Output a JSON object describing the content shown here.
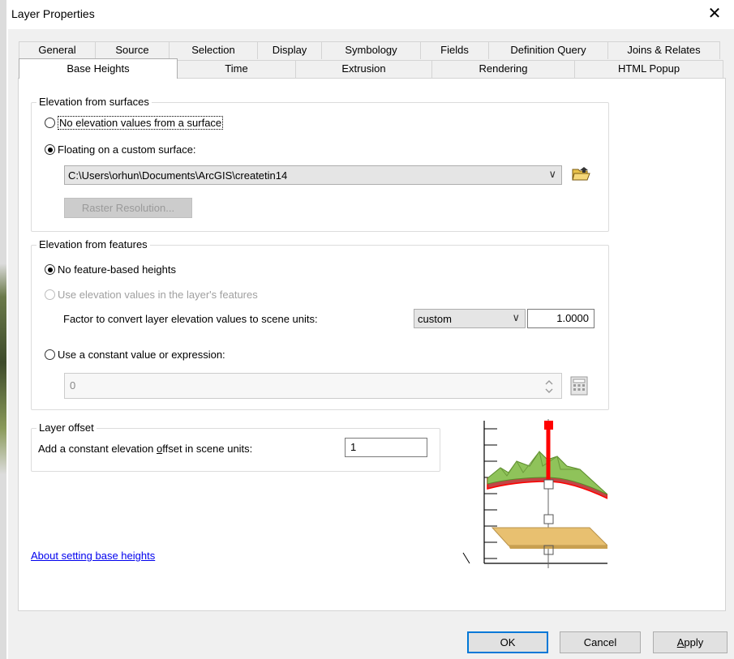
{
  "window": {
    "title": "Layer Properties",
    "close_glyph": "✕"
  },
  "tabs_row1": [
    "General",
    "Source",
    "Selection",
    "Display",
    "Symbology",
    "Fields",
    "Definition Query",
    "Joins & Relates"
  ],
  "tabs_row2": [
    "Base Heights",
    "Time",
    "Extrusion",
    "Rendering",
    "HTML Popup"
  ],
  "active_tab": "Base Heights",
  "surfaces": {
    "title": "Elevation from surfaces",
    "opt_none": "No elevation values from a surface",
    "opt_custom": "Floating on a custom surface:",
    "selected": "opt_custom",
    "surface_path": "C:\\Users\\orhun\\Documents\\ArcGIS\\createtin14",
    "raster_button": "Raster Resolution..."
  },
  "features": {
    "title": "Elevation from features",
    "opt_none": "No feature-based heights",
    "opt_use": "Use elevation values in the layer's features",
    "factor_label": "Factor to convert layer elevation values to scene units:",
    "factor_unit": "custom",
    "factor_value": "1.0000",
    "opt_constant": "Use a constant value or expression:",
    "constant_value": "0",
    "selected": "opt_none"
  },
  "offset": {
    "title": "Layer offset",
    "label": "Add a constant elevation offset in scene units:",
    "value": "1"
  },
  "help_link": "About setting base heights",
  "buttons": {
    "ok": "OK",
    "cancel": "Cancel",
    "apply": "Apply"
  },
  "icons": {
    "close": "close-icon",
    "chevron": "chevron-down-icon",
    "folder": "open-folder-icon",
    "calculator": "calculator-icon",
    "spinner": "spinner-icon"
  },
  "colors": {
    "terrain_green": "#7fbf4d",
    "surface_red": "#e53030",
    "plane_tan": "#e8c070",
    "focus_blue": "#0078d7"
  }
}
